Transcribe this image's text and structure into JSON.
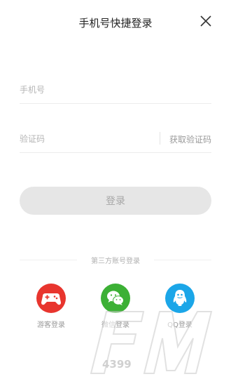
{
  "header": {
    "title": "手机号快捷登录",
    "close_icon": "close-icon"
  },
  "form": {
    "phone_placeholder": "手机号",
    "code_placeholder": "验证码",
    "get_code_label": "获取验证码",
    "login_label": "登录"
  },
  "third_party": {
    "divider_label": "第三方账号登录",
    "items": [
      {
        "label": "游客登录",
        "icon": "gamepad-icon",
        "color": "#e8352e"
      },
      {
        "label": "微信登录",
        "icon": "wechat-icon",
        "color": "#3cb035"
      },
      {
        "label": "QQ登录",
        "icon": "qq-penguin-icon",
        "color": "#1ba6e8"
      }
    ]
  },
  "watermark": {
    "text": "FM",
    "subtext": "4399"
  }
}
